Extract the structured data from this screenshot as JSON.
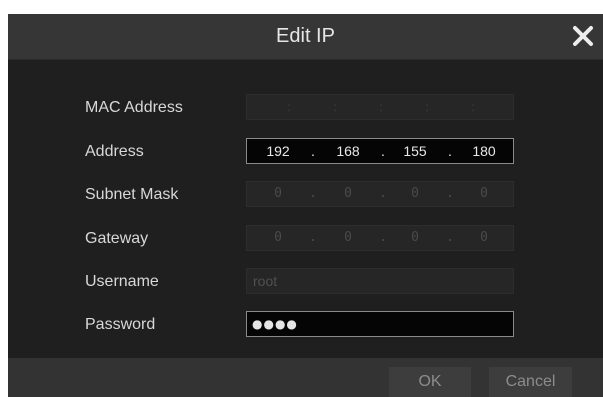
{
  "dialog": {
    "title": "Edit IP",
    "close_icon": "close-icon"
  },
  "fields": {
    "mac": {
      "label": "MAC Address",
      "value": ""
    },
    "address": {
      "label": "Address",
      "octets": [
        "192",
        "168",
        "155",
        "180"
      ]
    },
    "subnet": {
      "label": "Subnet Mask",
      "octets": [
        "0",
        "0",
        "0",
        "0"
      ]
    },
    "gateway": {
      "label": "Gateway",
      "octets": [
        "0",
        "0",
        "0",
        "0"
      ]
    },
    "username": {
      "label": "Username",
      "value": "root"
    },
    "password": {
      "label": "Password",
      "masked_value": "●●●●"
    }
  },
  "separators": {
    "ip": ".",
    "mac": ":"
  },
  "buttons": {
    "ok": "OK",
    "cancel": "Cancel"
  },
  "colors": {
    "dialog_bg": "#1f1f1f",
    "titlebar_bg": "#363636",
    "enabled_field_bg": "#050505",
    "disabled_field_bg": "#262626",
    "footer_bg": "#333333"
  }
}
